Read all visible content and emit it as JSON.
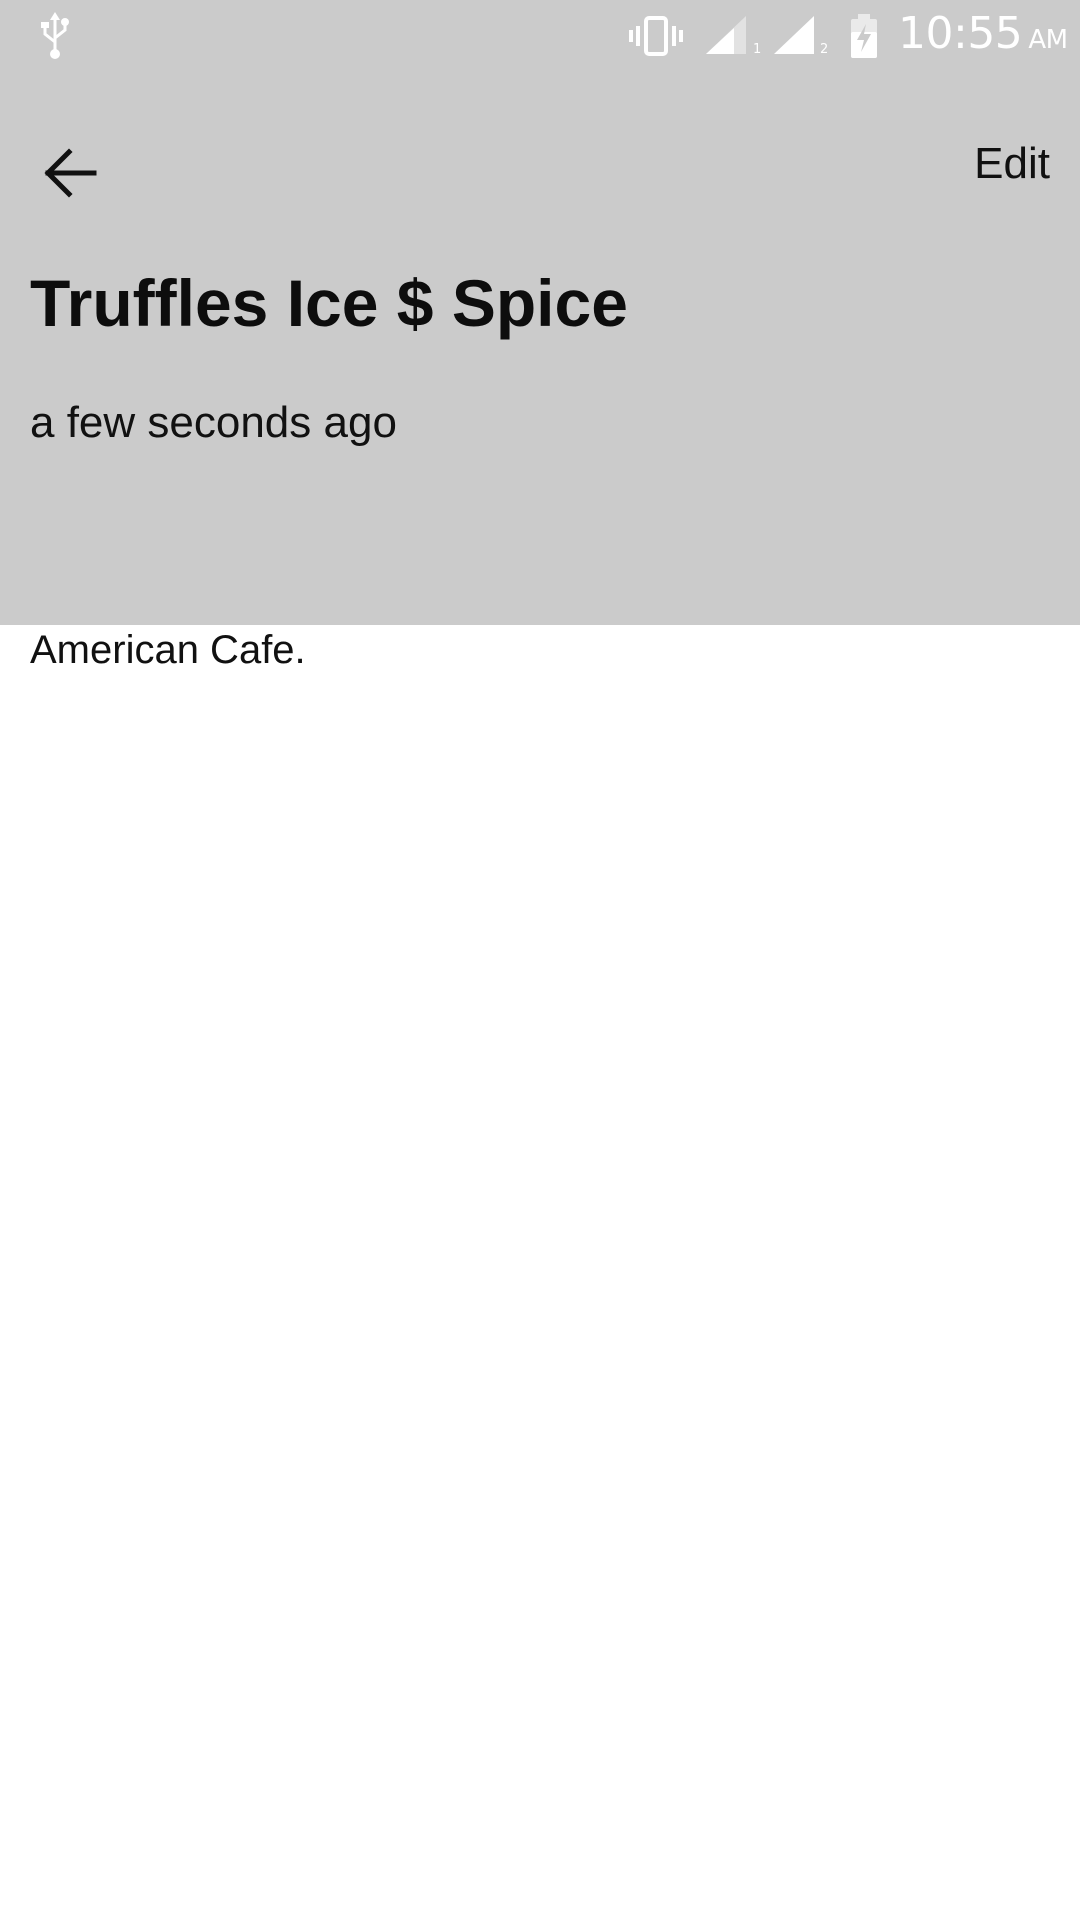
{
  "status_bar": {
    "time": "10:55",
    "ampm": "AM",
    "sim1_label": "1",
    "sim2_label": "2",
    "icons": [
      "usb-icon",
      "vibrate-icon",
      "signal-icon",
      "signal-icon",
      "battery-charging-icon"
    ]
  },
  "header": {
    "back_icon": "arrow-left-icon",
    "edit_label": "Edit",
    "title": "Truffles Ice $ Spice",
    "timestamp": "a few seconds ago",
    "background_color": "#cbcbcb"
  },
  "body": {
    "description": "American Cafe."
  }
}
